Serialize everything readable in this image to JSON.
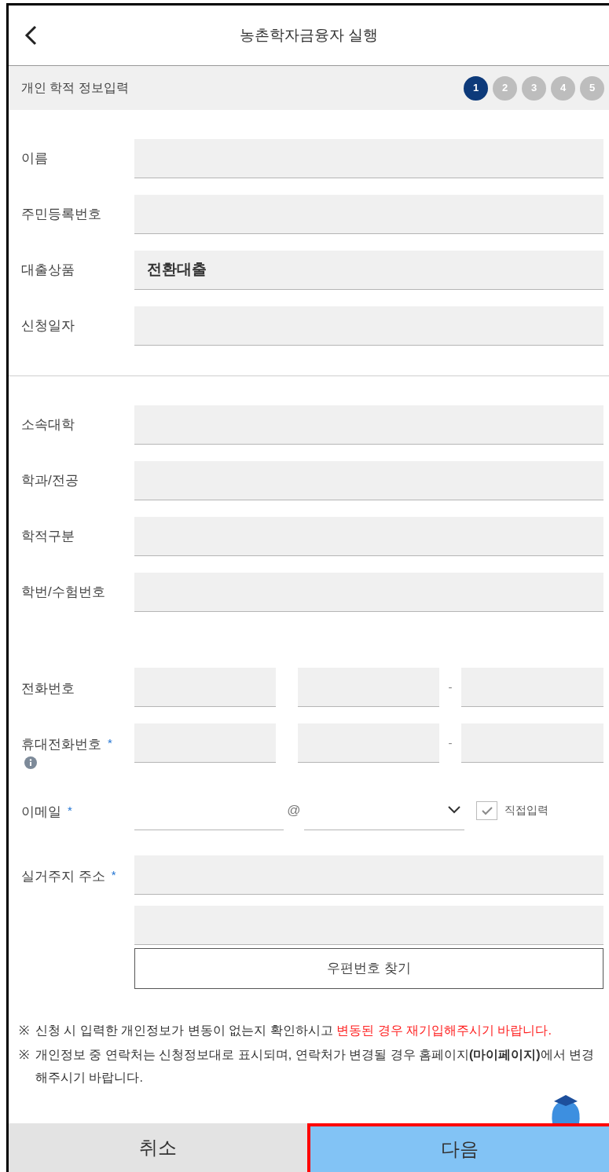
{
  "header": {
    "title": "농촌학자금융자 실행"
  },
  "section": {
    "title": "개인 학적 정보입력",
    "steps": [
      {
        "label": "1",
        "selected": true
      },
      {
        "label": "2",
        "selected": false
      },
      {
        "label": "3",
        "selected": false
      },
      {
        "label": "4",
        "selected": false
      },
      {
        "label": "5",
        "selected": false
      }
    ]
  },
  "personal_fields": [
    {
      "label": "이름"
    },
    {
      "label": "주민등록번호"
    },
    {
      "label": "대출상품",
      "value": "전환대출"
    },
    {
      "label": "신청일자"
    }
  ],
  "school_fields": [
    {
      "label": "소속대학"
    },
    {
      "label": "학과/전공"
    },
    {
      "label": "학적구분"
    },
    {
      "label": "학번/수험번호"
    }
  ],
  "phone": {
    "label": "전화번호",
    "separator": "-"
  },
  "mobile": {
    "label": "휴대전화번호",
    "required_mark": "*",
    "separator": "-"
  },
  "email": {
    "label": "이메일",
    "required_mark": "*",
    "at": "@",
    "direct_input": {
      "label": "직접입력",
      "checked": true
    }
  },
  "address": {
    "label": "실거주지 주소",
    "required_mark": "*",
    "search_button": "우편번호 찾기"
  },
  "notes": [
    {
      "mark": "※",
      "parts": [
        {
          "text": "신청 시 입력한 개인정보가 변동이 없는지 확인하시고 ",
          "highlight": false
        },
        {
          "text": "변동된 경우 재기입해주시기 바랍니다.",
          "highlight": true
        }
      ]
    },
    {
      "mark": "※",
      "parts": [
        {
          "text": "개인정보 중 연락처는 신청정보대로 표시되며, 연락처가 변경될 경우 홈페이지**(마이페이지)**에서 변경해주시기 바랍니다.",
          "highlight": false
        }
      ]
    }
  ],
  "buttons": [
    {
      "label": "취소",
      "kind": "secondary",
      "highlighted": false
    },
    {
      "label": "다음",
      "kind": "primary",
      "highlighted": true
    }
  ]
}
